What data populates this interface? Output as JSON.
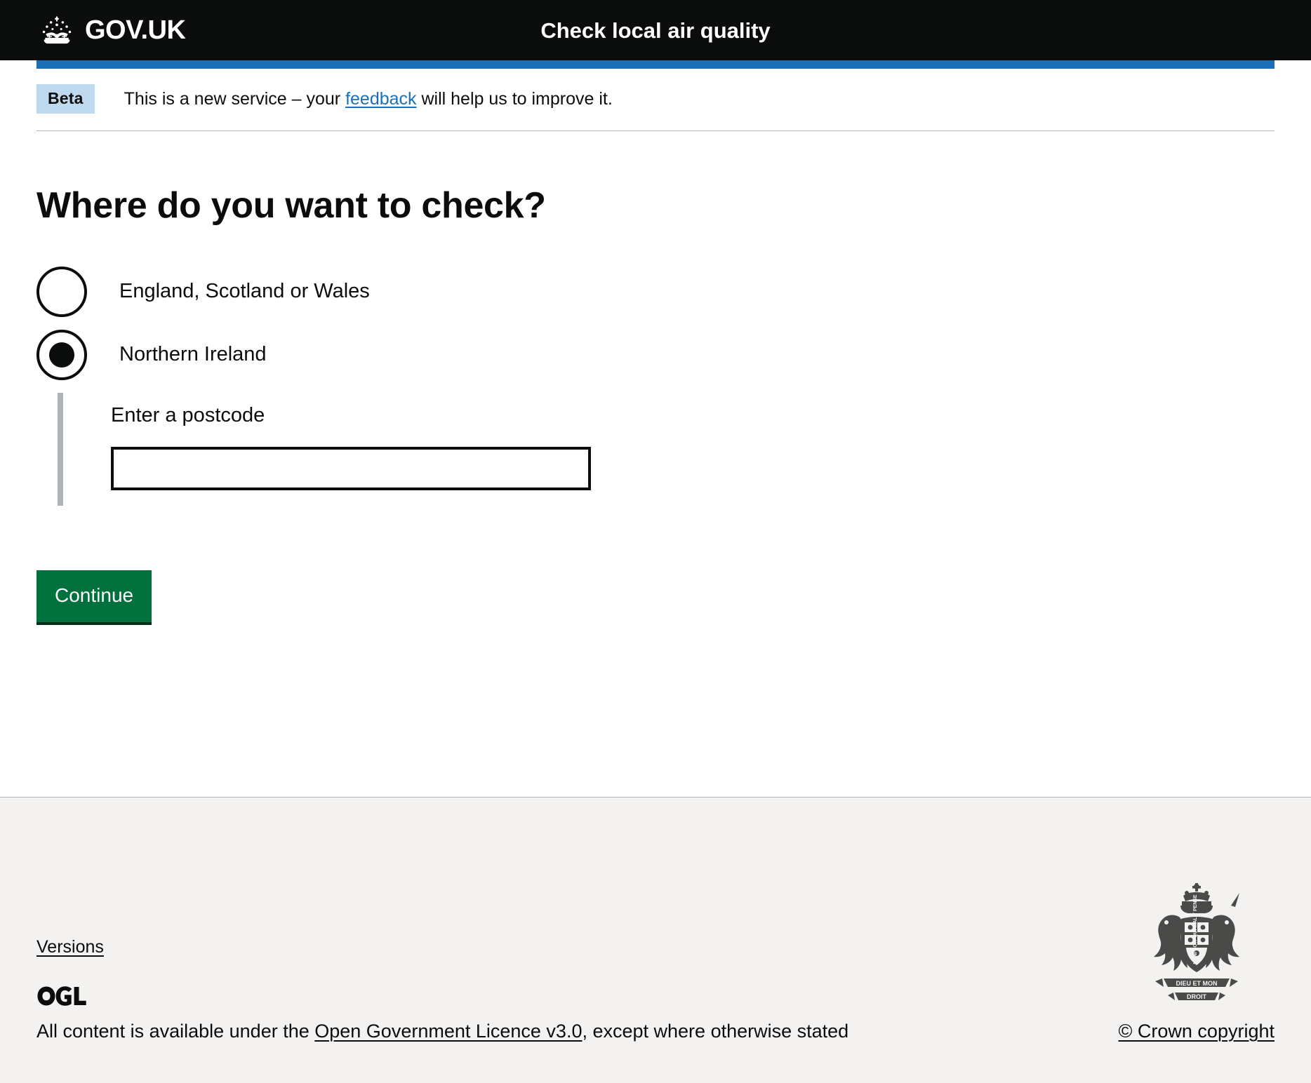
{
  "header": {
    "logo_text": "GOV.UK",
    "crown_icon": "crown-icon",
    "service_name": "Check local air quality"
  },
  "phase_banner": {
    "tag": "Beta",
    "text_before": "This is a new service – your ",
    "link": "feedback",
    "text_after": " will help us to improve it."
  },
  "main": {
    "heading": "Where do you want to check?",
    "radios": [
      {
        "label": "England, Scotland or Wales",
        "checked": false
      },
      {
        "label": "Northern Ireland",
        "checked": true
      }
    ],
    "conditional": {
      "label": "Enter a postcode",
      "input_value": "",
      "input_placeholder": ""
    },
    "continue_label": "Continue"
  },
  "footer": {
    "versions_label": "Versions",
    "ogl_logo_text": "OGL",
    "licence_before": "All content is available under the ",
    "licence_link": "Open Government Licence v3.0",
    "licence_after": ", except where otherwise stated",
    "crown_copyright": "© Crown copyright",
    "royal_arms_icon": "royal-coat-of-arms-icon"
  },
  "colors": {
    "header_bg": "#0b0c0c",
    "blue_bar": "#1d70b8",
    "link_blue": "#1d70b8",
    "beta_tag_bg": "#bfd9ee",
    "button_green": "#00703c",
    "button_shadow": "#002d18",
    "footer_bg": "#f3f2f1",
    "border_grey": "#b1b4b6",
    "text": "#0b0c0c"
  }
}
